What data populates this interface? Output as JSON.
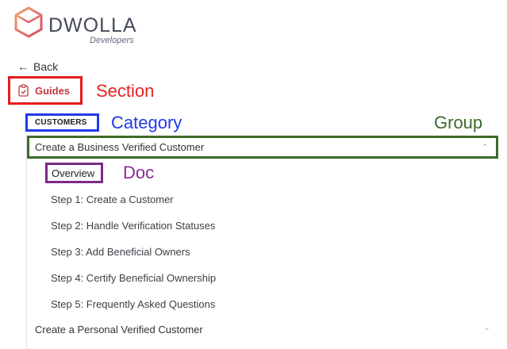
{
  "logo": {
    "word": "DWOLLA",
    "sub": "Developers"
  },
  "nav": {
    "back_label": "Back"
  },
  "section": {
    "label": "Guides"
  },
  "category": {
    "label": "CUSTOMERS"
  },
  "group": {
    "label": "Create a Business Verified Customer"
  },
  "doc": {
    "label": "Overview"
  },
  "steps": [
    "Step 1: Create a Customer",
    "Step 2: Handle Verification Statuses",
    "Step 3: Add Beneficial Owners",
    "Step 4: Certify Beneficial Ownership",
    "Step 5: Frequently Asked Questions"
  ],
  "next_group": {
    "label": "Create a Personal Verified Customer"
  },
  "annotations": {
    "section": "Section",
    "category": "Category",
    "group": "Group",
    "doc": "Doc"
  },
  "colors": {
    "section": "#e41c1c",
    "category": "#1f3ae8",
    "group": "#3d6b2a",
    "doc": "#7b2a86"
  }
}
